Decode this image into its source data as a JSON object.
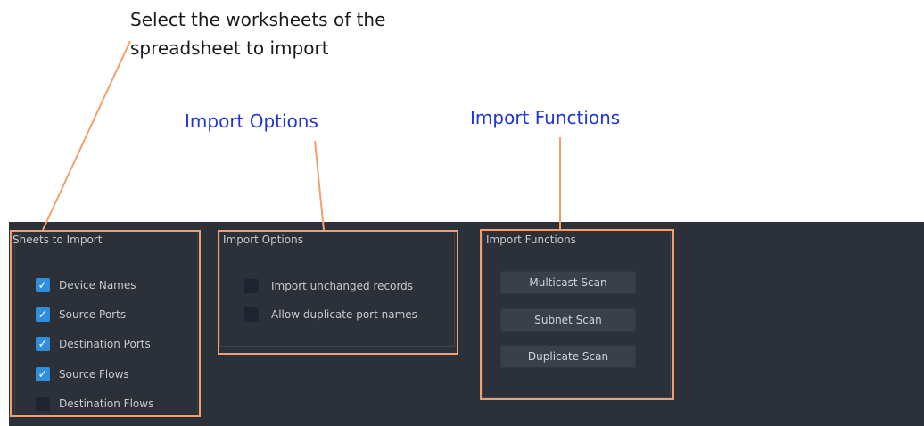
{
  "annotations": {
    "select_line1": "Select the worksheets of the",
    "select_line2": "spreadsheet to import",
    "import_options": "Import Options",
    "import_functions": "Import Functions"
  },
  "sheets": {
    "title": "Sheets to Import",
    "items": [
      {
        "label": "Device Names",
        "checked": true
      },
      {
        "label": "Source Ports",
        "checked": true
      },
      {
        "label": "Destination Ports",
        "checked": true
      },
      {
        "label": "Source Flows",
        "checked": true
      },
      {
        "label": "Destination Flows",
        "checked": false
      }
    ]
  },
  "options": {
    "title": "Import Options",
    "items": [
      {
        "label": "Import unchanged records",
        "checked": false
      },
      {
        "label": "Allow duplicate port names",
        "checked": false
      }
    ]
  },
  "functions": {
    "title": "Import Functions",
    "buttons": [
      "Multicast Scan",
      "Subnet Scan",
      "Duplicate Scan"
    ]
  },
  "colors": {
    "panel_bg": "#2b3039",
    "checkbox_checked": "#2f8fdc",
    "highlight": "#f2a06b",
    "annotation_link": "#1f35d9"
  },
  "icons": {
    "check": "checkmark-icon"
  }
}
